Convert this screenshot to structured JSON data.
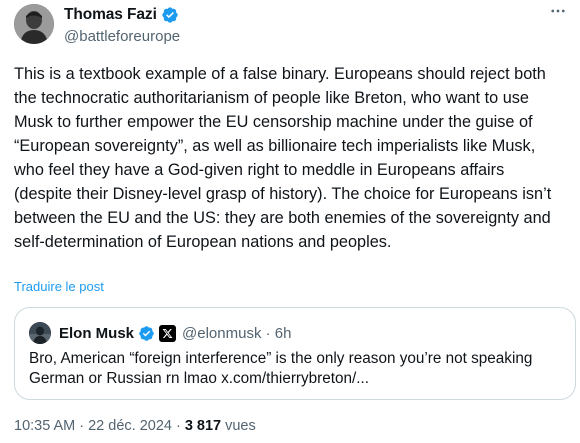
{
  "author": {
    "name": "Thomas Fazi",
    "handle": "@battleforeurope"
  },
  "icons": {
    "verified": "verified-badge-icon",
    "more": "more-options-icon",
    "affiliation": "x-logo-icon"
  },
  "colors": {
    "verified_blue": "#1d9bf0",
    "link_blue": "#1d9bf0",
    "secondary_text": "#536471",
    "border": "#cfd9de"
  },
  "tweet": {
    "text": "This is a textbook example of a false binary. Europeans should reject both the technocratic authoritarianism of people like Breton, who want to use Musk to further empower the EU censorship machine under the guise of “European sovereignty”, as well as billionaire tech imperialists like Musk, who feel they have a God-given right to meddle in Europeans affairs (despite their Disney-level grasp of history). The choice for Europeans isn’t between the EU and the US: they are both enemies of the sovereignty and self-determination of European nations and peoples.",
    "translate_label": "Traduire le post"
  },
  "quote": {
    "name": "Elon Musk",
    "handle_time": "@elonmusk · 6h",
    "text": "Bro, American “foreign interference” is the only reason you’re not speaking German or Russian rn lmao x.com/thierrybreton/..."
  },
  "meta": {
    "time": "10:35 AM",
    "separator": "·",
    "date": "22 déc. 2024",
    "views_count": "3 817",
    "views_label": "vues"
  }
}
